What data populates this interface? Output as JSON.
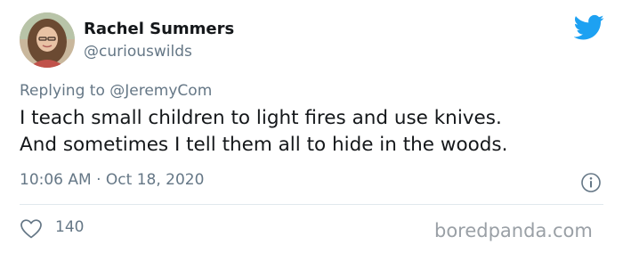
{
  "tweet": {
    "author": {
      "display_name": "Rachel Summers",
      "handle": "@curiouswilds",
      "avatar_icon": "avatar-photo"
    },
    "reply": {
      "prefix": "Replying to",
      "mention": "@JeremyCom"
    },
    "text_lines": [
      "I teach small children to light fires and use knives.",
      "And sometimes I tell them all to hide in the woods."
    ],
    "timestamp": "10:06 AM · Oct 18, 2020",
    "likes": "140",
    "icons": {
      "logo": "twitter-bird-icon",
      "info": "info-icon",
      "like": "heart-icon"
    }
  },
  "watermark": "boredpanda.com",
  "colors": {
    "twitter_blue": "#1da1f2",
    "secondary_text": "#657786",
    "primary_text": "#14171a",
    "divider": "#e1e8ed"
  }
}
